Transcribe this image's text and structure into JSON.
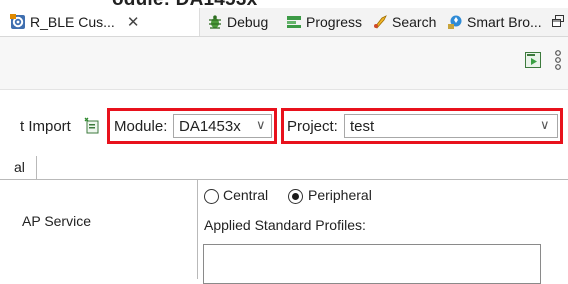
{
  "window": {
    "partial_title": "odule: DA1453x"
  },
  "tabs": [
    {
      "label": "R_BLE Cus...",
      "close": "✕",
      "icon": "gear-chip-icon"
    },
    {
      "label": "Debug",
      "icon": "debug-icon"
    },
    {
      "label": "Progress",
      "icon": "progress-icon"
    },
    {
      "label": "Search",
      "icon": "search-icon"
    },
    {
      "label": "Smart Bro...",
      "icon": "smart-browser-icon"
    }
  ],
  "header": {
    "import_label": "t Import",
    "module": {
      "label": "Module:",
      "value": "DA1453x"
    },
    "project": {
      "label": "Project:",
      "value": "test"
    }
  },
  "subtab": {
    "label": "al"
  },
  "left_panel": {
    "service_label": "AP Service"
  },
  "role": {
    "central": "Central",
    "peripheral": "Peripheral",
    "selected": "Peripheral"
  },
  "applied_profiles_label": "Applied Standard Profiles:",
  "colors": {
    "highlight": "#e8111c",
    "tab_bg": "#f3f3f3"
  }
}
